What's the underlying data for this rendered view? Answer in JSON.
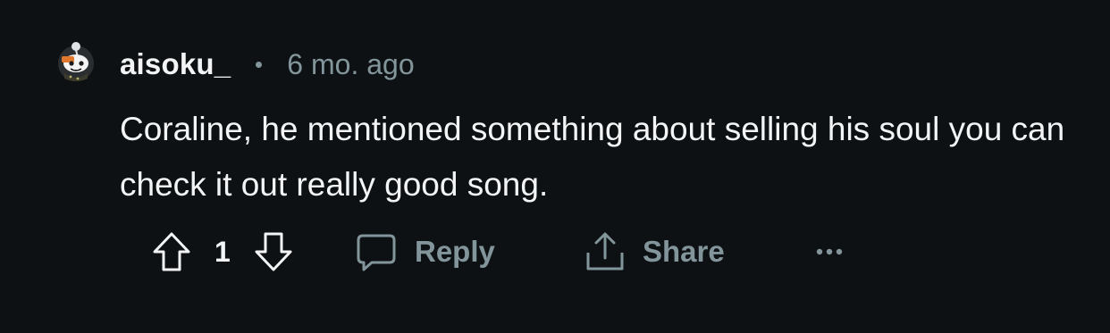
{
  "comment": {
    "author": "aisoku_",
    "separator": "•",
    "timestamp": "6 mo. ago",
    "body": "Coraline, he mentioned something about selling his soul you can check it out really good song.",
    "vote_count": "1"
  },
  "actions": {
    "reply_label": "Reply",
    "share_label": "Share",
    "more_label": "..."
  },
  "colors": {
    "background": "#0e1113",
    "text_primary": "#f2f4f5",
    "text_secondary": "#82959b"
  },
  "icons": {
    "upvote": "arrow-up-outline-icon",
    "downvote": "arrow-down-outline-icon",
    "reply": "speech-bubble-icon",
    "share": "share-upload-icon",
    "more": "ellipsis-icon"
  }
}
